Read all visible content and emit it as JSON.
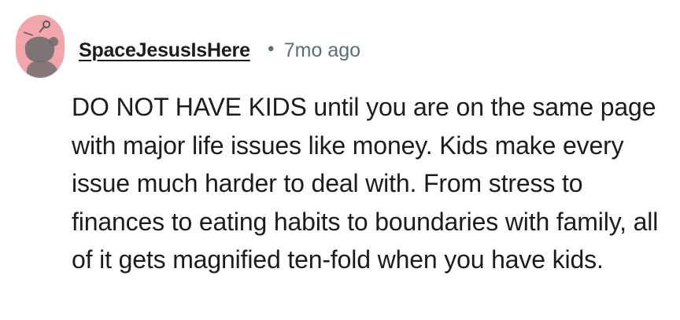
{
  "comment": {
    "author": "SpaceJesusIsHere",
    "separator": "•",
    "timestamp": "7mo ago",
    "body": "DO NOT HAVE KIDS until you are on the same page with major life issues like money. Kids make every issue much harder to deal with. From stress to finances to eating habits to boundaries with family, all of it gets magnified ten-fold when you have kids."
  },
  "avatar": {
    "icon": "snoo-avatar-icon",
    "background_color": "#f2a5ab",
    "figure_color": "#6b6b6b",
    "ground_color": "#ffffff"
  },
  "colors": {
    "text": "#1c1c1c",
    "meta": "#576f76",
    "background": "#ffffff"
  }
}
